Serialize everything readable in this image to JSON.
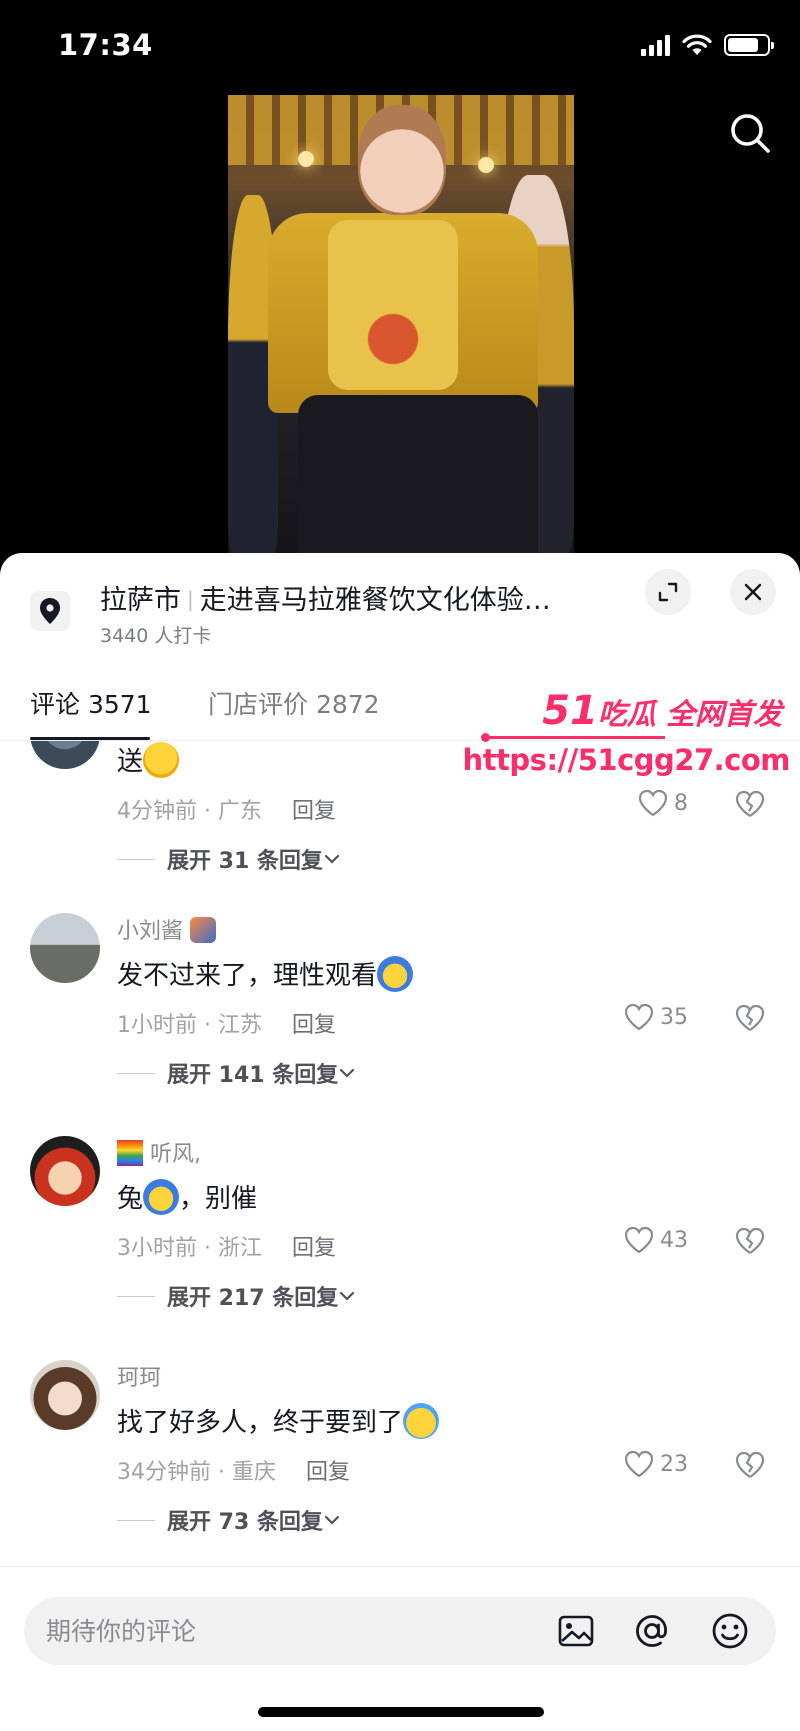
{
  "status_bar": {
    "time": "17:34",
    "battery_level_percent": 80
  },
  "video": {
    "search_icon": "search-icon"
  },
  "poi": {
    "city": "拉萨市",
    "name": "走进喜马拉雅餐饮文化体验…",
    "checkins": "3440 人打卡",
    "expand_icon": "expand-icon",
    "close_icon": "close-icon"
  },
  "tabs": [
    {
      "label": "评论 3571",
      "active": true
    },
    {
      "label": "门店评价 2872",
      "active": false
    }
  ],
  "watermark": {
    "number": "51",
    "brand": "吃瓜 全网首发",
    "url": "https://51cgg27.com"
  },
  "comments": [
    {
      "name": "",
      "text": "送",
      "time": "4分钟前",
      "region": "广东",
      "reply": "回复",
      "likes": "8",
      "expand": "展开 31 条回复"
    },
    {
      "name": "小刘酱",
      "text": "发不过来了，理性观看",
      "time": "1小时前",
      "region": "江苏",
      "reply": "回复",
      "likes": "35",
      "expand": "展开 141 条回复"
    },
    {
      "name": "听风,",
      "text": "兔",
      "text_suffix": "，别催",
      "time": "3小时前",
      "region": "浙江",
      "reply": "回复",
      "likes": "43",
      "expand": "展开 217 条回复"
    },
    {
      "name": "珂珂",
      "text": "找了好多人，终于要到了",
      "time": "34分钟前",
      "region": "重庆",
      "reply": "回复",
      "likes": "23",
      "expand": "展开 73 条回复"
    }
  ],
  "input": {
    "placeholder": "期待你的评论"
  },
  "colors": {
    "accent": "#ff2d6a",
    "text": "#161823",
    "muted": "#8a8b91"
  }
}
